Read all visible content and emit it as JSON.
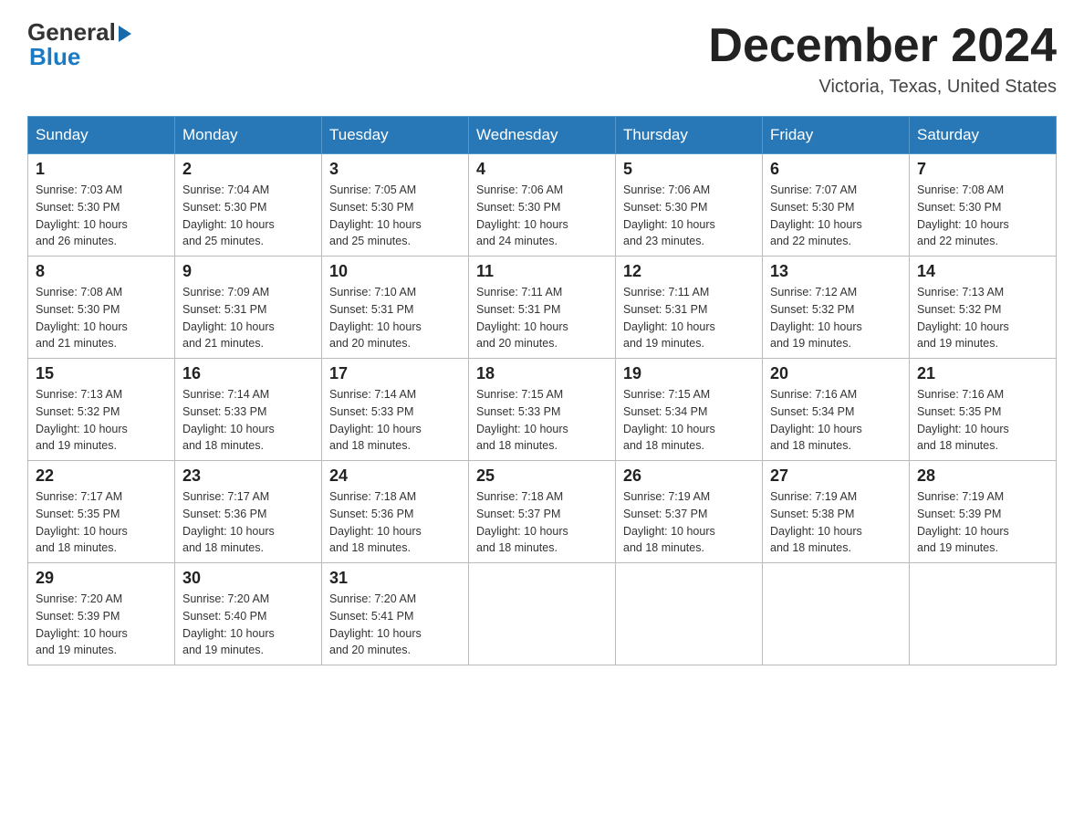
{
  "logo": {
    "general_text": "General",
    "blue_text": "Blue"
  },
  "title": "December 2024",
  "location": "Victoria, Texas, United States",
  "days_of_week": [
    "Sunday",
    "Monday",
    "Tuesday",
    "Wednesday",
    "Thursday",
    "Friday",
    "Saturday"
  ],
  "weeks": [
    [
      {
        "day": "1",
        "info": "Sunrise: 7:03 AM\nSunset: 5:30 PM\nDaylight: 10 hours\nand 26 minutes."
      },
      {
        "day": "2",
        "info": "Sunrise: 7:04 AM\nSunset: 5:30 PM\nDaylight: 10 hours\nand 25 minutes."
      },
      {
        "day": "3",
        "info": "Sunrise: 7:05 AM\nSunset: 5:30 PM\nDaylight: 10 hours\nand 25 minutes."
      },
      {
        "day": "4",
        "info": "Sunrise: 7:06 AM\nSunset: 5:30 PM\nDaylight: 10 hours\nand 24 minutes."
      },
      {
        "day": "5",
        "info": "Sunrise: 7:06 AM\nSunset: 5:30 PM\nDaylight: 10 hours\nand 23 minutes."
      },
      {
        "day": "6",
        "info": "Sunrise: 7:07 AM\nSunset: 5:30 PM\nDaylight: 10 hours\nand 22 minutes."
      },
      {
        "day": "7",
        "info": "Sunrise: 7:08 AM\nSunset: 5:30 PM\nDaylight: 10 hours\nand 22 minutes."
      }
    ],
    [
      {
        "day": "8",
        "info": "Sunrise: 7:08 AM\nSunset: 5:30 PM\nDaylight: 10 hours\nand 21 minutes."
      },
      {
        "day": "9",
        "info": "Sunrise: 7:09 AM\nSunset: 5:31 PM\nDaylight: 10 hours\nand 21 minutes."
      },
      {
        "day": "10",
        "info": "Sunrise: 7:10 AM\nSunset: 5:31 PM\nDaylight: 10 hours\nand 20 minutes."
      },
      {
        "day": "11",
        "info": "Sunrise: 7:11 AM\nSunset: 5:31 PM\nDaylight: 10 hours\nand 20 minutes."
      },
      {
        "day": "12",
        "info": "Sunrise: 7:11 AM\nSunset: 5:31 PM\nDaylight: 10 hours\nand 19 minutes."
      },
      {
        "day": "13",
        "info": "Sunrise: 7:12 AM\nSunset: 5:32 PM\nDaylight: 10 hours\nand 19 minutes."
      },
      {
        "day": "14",
        "info": "Sunrise: 7:13 AM\nSunset: 5:32 PM\nDaylight: 10 hours\nand 19 minutes."
      }
    ],
    [
      {
        "day": "15",
        "info": "Sunrise: 7:13 AM\nSunset: 5:32 PM\nDaylight: 10 hours\nand 19 minutes."
      },
      {
        "day": "16",
        "info": "Sunrise: 7:14 AM\nSunset: 5:33 PM\nDaylight: 10 hours\nand 18 minutes."
      },
      {
        "day": "17",
        "info": "Sunrise: 7:14 AM\nSunset: 5:33 PM\nDaylight: 10 hours\nand 18 minutes."
      },
      {
        "day": "18",
        "info": "Sunrise: 7:15 AM\nSunset: 5:33 PM\nDaylight: 10 hours\nand 18 minutes."
      },
      {
        "day": "19",
        "info": "Sunrise: 7:15 AM\nSunset: 5:34 PM\nDaylight: 10 hours\nand 18 minutes."
      },
      {
        "day": "20",
        "info": "Sunrise: 7:16 AM\nSunset: 5:34 PM\nDaylight: 10 hours\nand 18 minutes."
      },
      {
        "day": "21",
        "info": "Sunrise: 7:16 AM\nSunset: 5:35 PM\nDaylight: 10 hours\nand 18 minutes."
      }
    ],
    [
      {
        "day": "22",
        "info": "Sunrise: 7:17 AM\nSunset: 5:35 PM\nDaylight: 10 hours\nand 18 minutes."
      },
      {
        "day": "23",
        "info": "Sunrise: 7:17 AM\nSunset: 5:36 PM\nDaylight: 10 hours\nand 18 minutes."
      },
      {
        "day": "24",
        "info": "Sunrise: 7:18 AM\nSunset: 5:36 PM\nDaylight: 10 hours\nand 18 minutes."
      },
      {
        "day": "25",
        "info": "Sunrise: 7:18 AM\nSunset: 5:37 PM\nDaylight: 10 hours\nand 18 minutes."
      },
      {
        "day": "26",
        "info": "Sunrise: 7:19 AM\nSunset: 5:37 PM\nDaylight: 10 hours\nand 18 minutes."
      },
      {
        "day": "27",
        "info": "Sunrise: 7:19 AM\nSunset: 5:38 PM\nDaylight: 10 hours\nand 18 minutes."
      },
      {
        "day": "28",
        "info": "Sunrise: 7:19 AM\nSunset: 5:39 PM\nDaylight: 10 hours\nand 19 minutes."
      }
    ],
    [
      {
        "day": "29",
        "info": "Sunrise: 7:20 AM\nSunset: 5:39 PM\nDaylight: 10 hours\nand 19 minutes."
      },
      {
        "day": "30",
        "info": "Sunrise: 7:20 AM\nSunset: 5:40 PM\nDaylight: 10 hours\nand 19 minutes."
      },
      {
        "day": "31",
        "info": "Sunrise: 7:20 AM\nSunset: 5:41 PM\nDaylight: 10 hours\nand 20 minutes."
      },
      {
        "day": "",
        "info": ""
      },
      {
        "day": "",
        "info": ""
      },
      {
        "day": "",
        "info": ""
      },
      {
        "day": "",
        "info": ""
      }
    ]
  ]
}
